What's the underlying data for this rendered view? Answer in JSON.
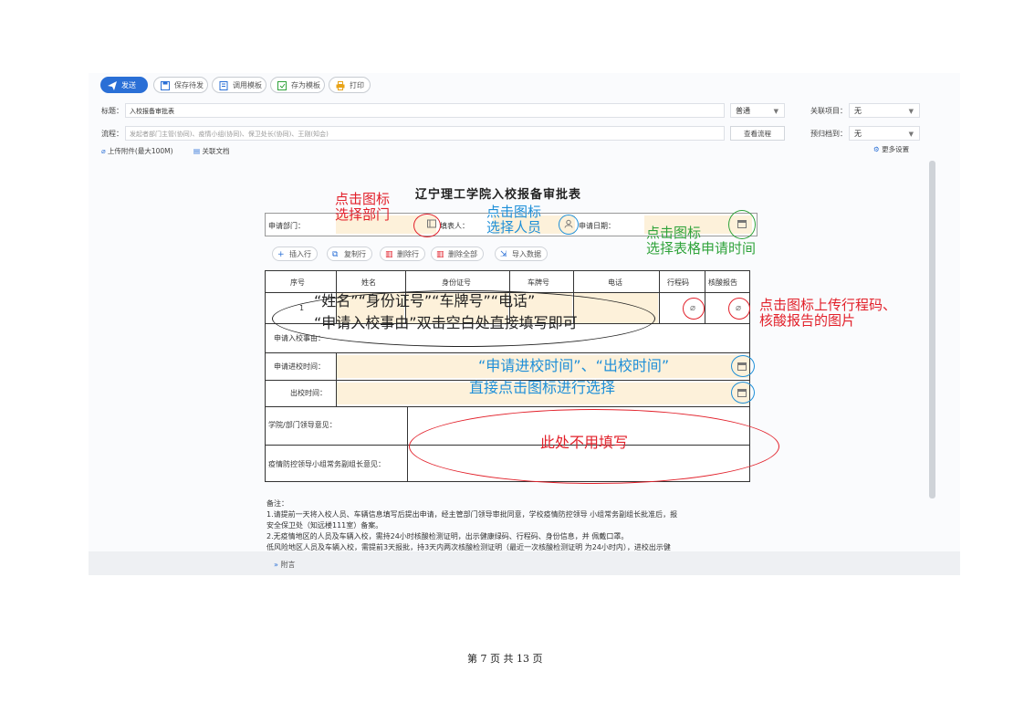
{
  "toolbar": {
    "send": "发送",
    "save_draft": "保存待发",
    "use_template": "调用模板",
    "save_template": "存为模板",
    "print": "打印"
  },
  "header": {
    "title_label": "标题：",
    "title_value": "入校报备审批表",
    "priority": "普通",
    "related_project_label": "关联项目：",
    "related_project_value": "无",
    "flow_label": "流程：",
    "flow_value": "发起者部门主管(协同)、疫情小组(协同)、保卫处长(协同)、王刚(知会)",
    "view_flow": "查看流程",
    "archive_label": "预归档到：",
    "archive_value": "无",
    "upload": "上传附件(最大100M)",
    "related_doc": "关联文档",
    "more_settings": "更多设置"
  },
  "form": {
    "title": "辽宁理工学院入校报备审批表",
    "dept_label": "申请部门：",
    "person_label": "填表人：",
    "date_label": "申请日期：",
    "row_buttons": [
      "插入行",
      "复制行",
      "删除行",
      "删除全部",
      "导入数据"
    ],
    "columns": [
      "序号",
      "姓名",
      "身份证号",
      "车牌号",
      "电话",
      "行程码",
      "核酸报告"
    ],
    "row_index": "1",
    "reason_label": "申请入校事由：",
    "enter_time_label": "申请进校时间：",
    "exit_time_label": "出校时间：",
    "leader_opinion_label": "学院/部门领导意见：",
    "epidemic_opinion_label": "疫情防控领导小组常务副组长意见：",
    "notes": [
      "备注：",
      "1.请提前一天将入校人员、车辆信息填写后提出申请，经主管部门领导审批同意，学校疫情防控领导 小组常务副组长批准后，报",
      "安全保卫处（知远楼111室）备案。",
      "2.无疫情地区的人员及车辆入校，需持24小时核酸检测证明，出示健康绿码、行程码、身份信息，并 佩戴口罩。",
      "  低风险地区人员及车辆入校，需提前3天报批，持3天内两次核酸检测证明（最近一次核酸检测证明 为24小时内），进校出示健"
    ]
  },
  "annotations": {
    "dept": [
      "点击图标",
      "选择部门"
    ],
    "person": [
      "点击图标",
      "选择人员"
    ],
    "date": [
      "点击图标",
      "选择表格申请时间"
    ],
    "fields": "“姓名”“身份证号”“车牌号”“电话”",
    "reason": "“申请入校事由”双击空白处直接填写即可",
    "upload": [
      "点击图标上传行程码、",
      "核酸报告的图片"
    ],
    "times": [
      "“申请进校时间”、“出校时间”",
      "直接点击图标进行选择"
    ],
    "no_fill": "此处不用填写"
  },
  "footer": {
    "attachment": "附言",
    "page": "第 7 页 共 13 页"
  },
  "colors": {
    "accent": "#2a6fd6",
    "red": "#e2202a",
    "blue": "#1e8fd8",
    "green": "#2fa33a",
    "field_fill": "#fdf1da"
  }
}
